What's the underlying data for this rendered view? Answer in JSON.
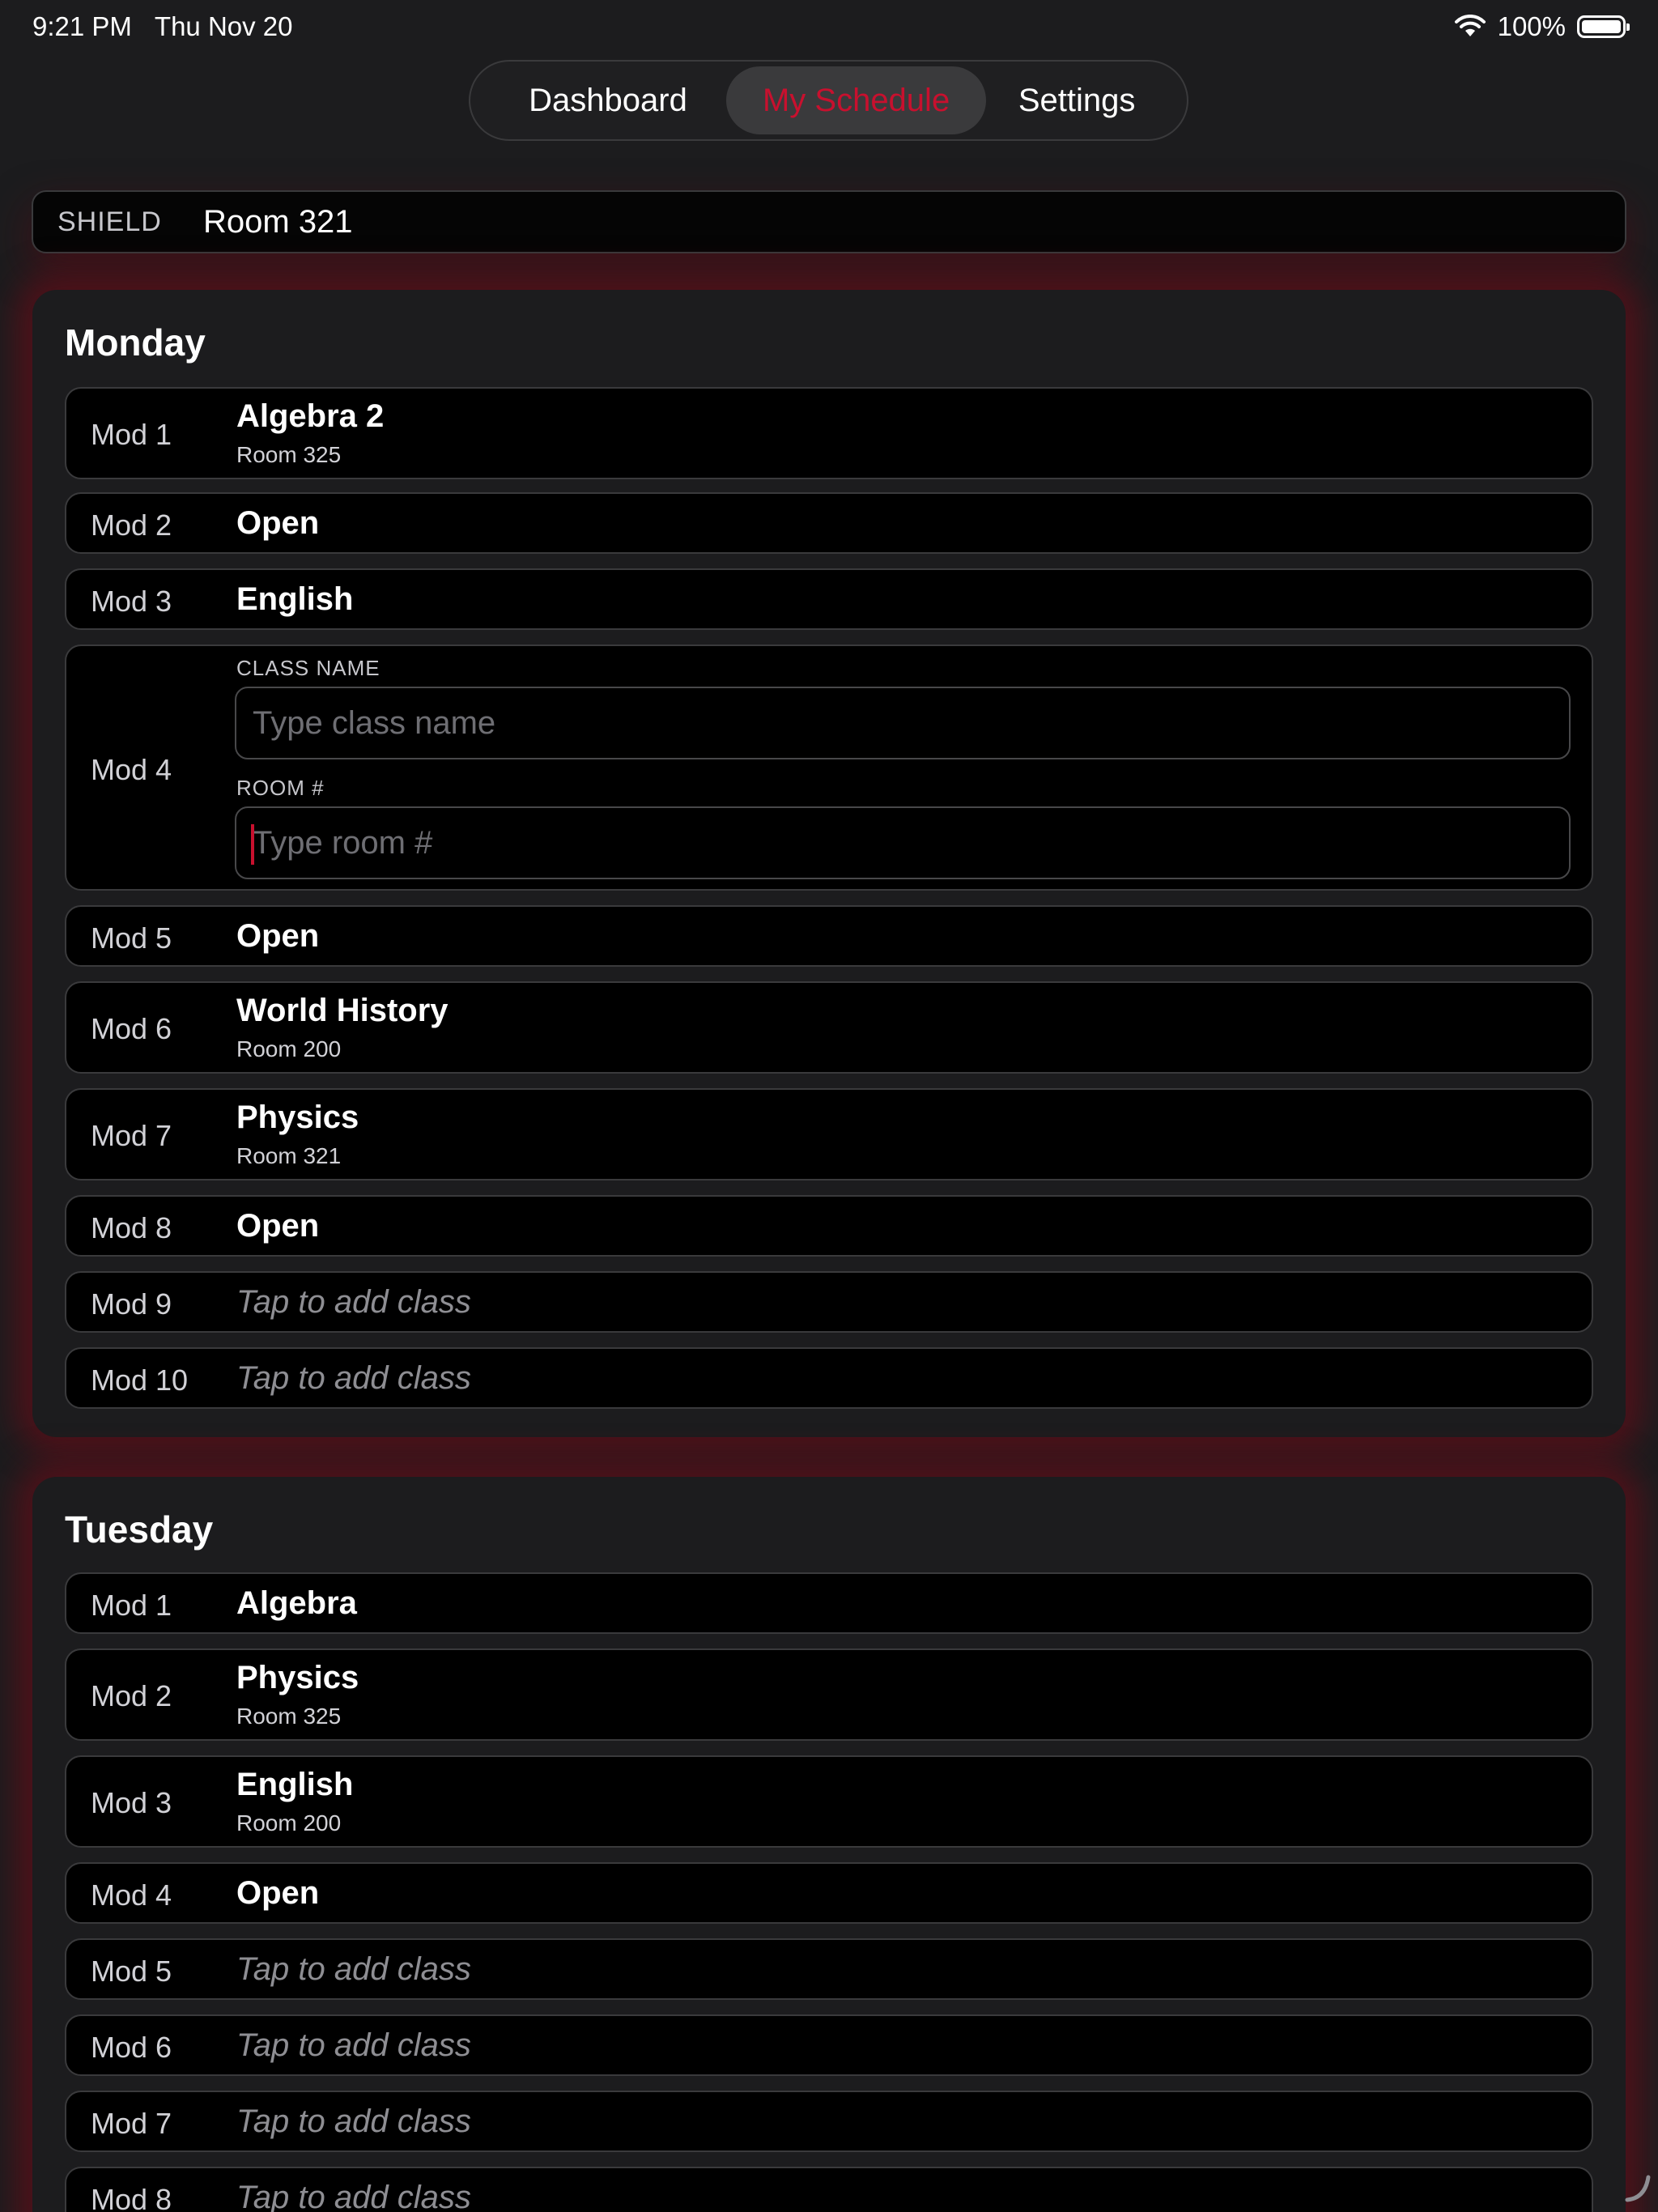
{
  "status_bar": {
    "time": "9:21 PM",
    "date": "Thu Nov 20",
    "battery": "100%"
  },
  "tabs": [
    {
      "label": "Dashboard",
      "selected": false
    },
    {
      "label": "My Schedule",
      "selected": true
    },
    {
      "label": "Settings",
      "selected": false
    }
  ],
  "shield": {
    "label": "SHIELD",
    "value": "Room 321"
  },
  "accent_color": "#c8102e",
  "days": {
    "monday": {
      "title": "Monday",
      "mods": [
        {
          "label": "Mod 1",
          "name": "Algebra 2",
          "room": "Room 325"
        },
        {
          "label": "Mod 2",
          "name": "Open"
        },
        {
          "label": "Mod 3",
          "name": "English"
        },
        {
          "label": "Mod 4",
          "class_name_label": "CLASS NAME",
          "class_name_placeholder": "Type class name",
          "room_label": "ROOM #",
          "room_placeholder": "Type room #"
        },
        {
          "label": "Mod 5",
          "name": "Open"
        },
        {
          "label": "Mod 6",
          "name": "World History",
          "room": "Room 200"
        },
        {
          "label": "Mod 7",
          "name": "Physics",
          "room": "Room 321"
        },
        {
          "label": "Mod 8",
          "name": "Open"
        },
        {
          "label": "Mod 9",
          "placeholder": "Tap to add class"
        },
        {
          "label": "Mod 10",
          "placeholder": "Tap to add class"
        }
      ]
    },
    "tuesday": {
      "title": "Tuesday",
      "mods": [
        {
          "label": "Mod 1",
          "name": "Algebra"
        },
        {
          "label": "Mod 2",
          "name": "Physics",
          "room": "Room 325"
        },
        {
          "label": "Mod 3",
          "name": "English",
          "room": "Room 200"
        },
        {
          "label": "Mod 4",
          "name": "Open"
        },
        {
          "label": "Mod 5",
          "placeholder": "Tap to add class"
        },
        {
          "label": "Mod 6",
          "placeholder": "Tap to add class"
        },
        {
          "label": "Mod 7",
          "placeholder": "Tap to add class"
        },
        {
          "label": "Mod 8",
          "placeholder": "Tap to add class"
        }
      ]
    }
  }
}
